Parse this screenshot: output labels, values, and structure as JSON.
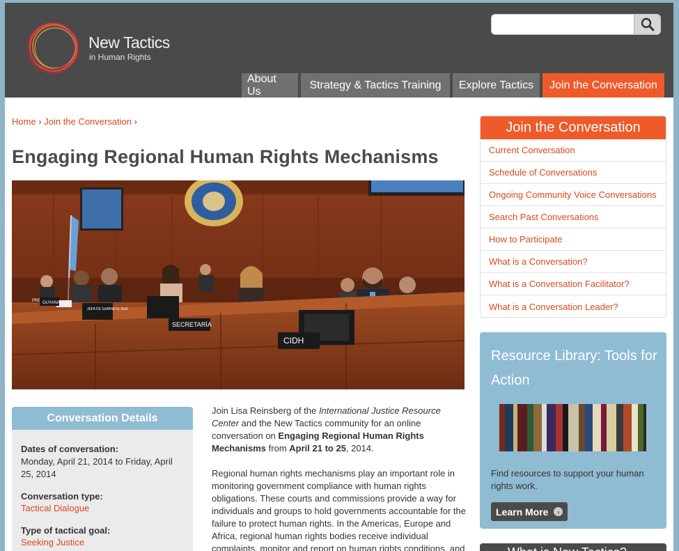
{
  "header": {
    "logo_title": "New Tactics",
    "logo_subtitle": "in Human Rights",
    "search": {
      "value": "",
      "placeholder": "",
      "icon": "search-icon"
    },
    "nav": [
      {
        "label": "About Us",
        "active": false
      },
      {
        "label": "Strategy & Tactics Training",
        "active": false
      },
      {
        "label": "Explore Tactics",
        "active": false
      },
      {
        "label": "Join the Conversation",
        "active": true
      }
    ]
  },
  "breadcrumb": {
    "items": [
      "Home",
      "Join the Conversation"
    ],
    "separator": "›"
  },
  "page_title": "Engaging Regional Human Rights Mechanisms",
  "hero": {
    "nameplates": [
      "JEFA DE GABINETE SGA",
      "SECRETARÍA",
      "CIDH",
      "GUYANA",
      "PRESIDENTE"
    ]
  },
  "details": {
    "title": "Conversation Details",
    "dates_label": "Dates of conversation:",
    "dates_value": "Monday, April 21, 2014 to Friday, April 25, 2014",
    "type_label": "Conversation type:",
    "type_value": "Tactical Dialogue",
    "goal_label": "Type of tactical goal:",
    "goal_value": "Seeking Justice"
  },
  "body": {
    "p1_a": "Join Lisa Reinsberg of the ",
    "p1_b": "International Justice Resource Center",
    "p1_c": " and the New Tactics community for an online conversation on ",
    "p1_d": "Engaging Regional Human Rights Mechanisms",
    "p1_e": " from ",
    "p1_f": "April 21 to 25",
    "p1_g": ", 2014.",
    "p2": "Regional human rights mechanisms play an important role in monitoring government compliance with human rights obligations. These courts and commissions provide a way for individuals and groups to hold governments accountable for the failure to protect human rights. In the Americas, Europe and Africa, regional human rights bodies receive individual complaints, monitor and report on human rights conditions, and"
  },
  "sidebar": {
    "conversation": {
      "title": "Join the Conversation",
      "items": [
        "Current Conversation",
        "Schedule of Conversations",
        "Ongoing Community Voice Conversations",
        "Search Past Conversations",
        "How to Participate",
        "What is a Conversation?",
        "What is a Conversation Facilitator?",
        "What is a Conversation Leader?"
      ]
    },
    "resource": {
      "title": "Resource Library: Tools for Action",
      "text": "Find resources to support your human rights work.",
      "button": "Learn More"
    },
    "next_box_title": "What is New Tactics?"
  },
  "colors": {
    "accent": "#ee5a2a",
    "link": "#d9481c",
    "header_bg": "#4a4a4a",
    "nav_gray": "#707070",
    "panel_blue": "#8fbbd3"
  }
}
